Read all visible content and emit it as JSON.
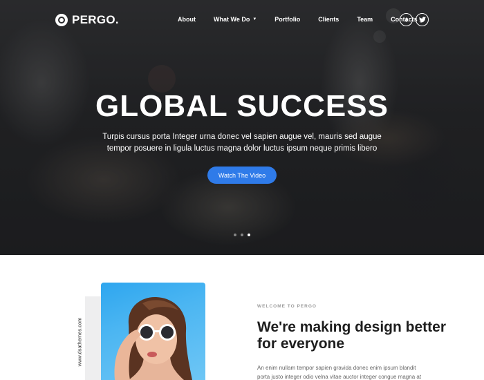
{
  "brand": {
    "name": "PERGO."
  },
  "nav": {
    "items": [
      {
        "label": "About"
      },
      {
        "label": "What We Do"
      },
      {
        "label": "Portfolio"
      },
      {
        "label": "Clients"
      },
      {
        "label": "Team"
      },
      {
        "label": "Contacts"
      }
    ]
  },
  "social": {
    "facebook_glyph": "f"
  },
  "hero": {
    "title": "GLOBAL SUCCESS",
    "subtitle": "Turpis cursus porta Integer urna donec vel sapien augue vel, mauris sed augue tempor posuere in ligula luctus magna dolor luctus ipsum neque primis libero",
    "cta_label": "Watch The Video",
    "slides": {
      "count": 3,
      "active_index": 3
    }
  },
  "about": {
    "vertical_text": "www.dsathemes.com",
    "eyebrow": "WELCOME TO PERGO",
    "heading": "We're making design better for everyone",
    "paragraph": "An enim nullam tempor sapien gravida donec enim ipsum blandit porta justo integer odio velna vitae auctor integer congue magna at"
  },
  "colors": {
    "accent": "#2f7be9",
    "heading_text": "#1d1d1d",
    "body_text": "#666666",
    "eyebrow_text": "#9a9a9a",
    "photo_background": "#4cb6f2"
  },
  "icons": {
    "logo": "logo-ring-icon",
    "caret": "chevron-down-icon",
    "facebook": "facebook-icon",
    "twitter": "twitter-icon"
  }
}
